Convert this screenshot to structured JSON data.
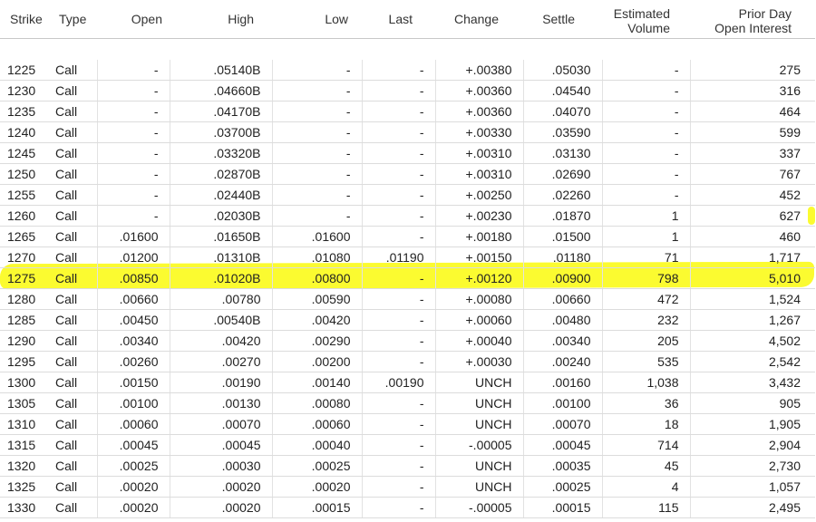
{
  "columns": {
    "strike": "Strike",
    "type": "Type",
    "open": "Open",
    "high": "High",
    "low": "Low",
    "last": "Last",
    "change": "Change",
    "settle": "Settle",
    "volume_line1": "Estimated",
    "volume_line2": "Volume",
    "oi_line1": "Prior Day",
    "oi_line2": "Open Interest"
  },
  "highlight_color": "#fbfb1e",
  "highlighted_strike": "1275",
  "rows": [
    {
      "strike": "1225",
      "type": "Call",
      "open": "-",
      "high": ".05140B",
      "low": "-",
      "last": "-",
      "change": "+.00380",
      "settle": ".05030",
      "volume": "-",
      "open_interest": "275"
    },
    {
      "strike": "1230",
      "type": "Call",
      "open": "-",
      "high": ".04660B",
      "low": "-",
      "last": "-",
      "change": "+.00360",
      "settle": ".04540",
      "volume": "-",
      "open_interest": "316"
    },
    {
      "strike": "1235",
      "type": "Call",
      "open": "-",
      "high": ".04170B",
      "low": "-",
      "last": "-",
      "change": "+.00360",
      "settle": ".04070",
      "volume": "-",
      "open_interest": "464"
    },
    {
      "strike": "1240",
      "type": "Call",
      "open": "-",
      "high": ".03700B",
      "low": "-",
      "last": "-",
      "change": "+.00330",
      "settle": ".03590",
      "volume": "-",
      "open_interest": "599"
    },
    {
      "strike": "1245",
      "type": "Call",
      "open": "-",
      "high": ".03320B",
      "low": "-",
      "last": "-",
      "change": "+.00310",
      "settle": ".03130",
      "volume": "-",
      "open_interest": "337"
    },
    {
      "strike": "1250",
      "type": "Call",
      "open": "-",
      "high": ".02870B",
      "low": "-",
      "last": "-",
      "change": "+.00310",
      "settle": ".02690",
      "volume": "-",
      "open_interest": "767"
    },
    {
      "strike": "1255",
      "type": "Call",
      "open": "-",
      "high": ".02440B",
      "low": "-",
      "last": "-",
      "change": "+.00250",
      "settle": ".02260",
      "volume": "-",
      "open_interest": "452"
    },
    {
      "strike": "1260",
      "type": "Call",
      "open": "-",
      "high": ".02030B",
      "low": "-",
      "last": "-",
      "change": "+.00230",
      "settle": ".01870",
      "volume": "1",
      "open_interest": "627"
    },
    {
      "strike": "1265",
      "type": "Call",
      "open": ".01600",
      "high": ".01650B",
      "low": ".01600",
      "last": "-",
      "change": "+.00180",
      "settle": ".01500",
      "volume": "1",
      "open_interest": "460"
    },
    {
      "strike": "1270",
      "type": "Call",
      "open": ".01200",
      "high": ".01310B",
      "low": ".01080",
      "last": ".01190",
      "change": "+.00150",
      "settle": ".01180",
      "volume": "71",
      "open_interest": "1,717"
    },
    {
      "strike": "1275",
      "type": "Call",
      "open": ".00850",
      "high": ".01020B",
      "low": ".00800",
      "last": "-",
      "change": "+.00120",
      "settle": ".00900",
      "volume": "798",
      "open_interest": "5,010"
    },
    {
      "strike": "1280",
      "type": "Call",
      "open": ".00660",
      "high": ".00780",
      "low": ".00590",
      "last": "-",
      "change": "+.00080",
      "settle": ".00660",
      "volume": "472",
      "open_interest": "1,524"
    },
    {
      "strike": "1285",
      "type": "Call",
      "open": ".00450",
      "high": ".00540B",
      "low": ".00420",
      "last": "-",
      "change": "+.00060",
      "settle": ".00480",
      "volume": "232",
      "open_interest": "1,267"
    },
    {
      "strike": "1290",
      "type": "Call",
      "open": ".00340",
      "high": ".00420",
      "low": ".00290",
      "last": "-",
      "change": "+.00040",
      "settle": ".00340",
      "volume": "205",
      "open_interest": "4,502"
    },
    {
      "strike": "1295",
      "type": "Call",
      "open": ".00260",
      "high": ".00270",
      "low": ".00200",
      "last": "-",
      "change": "+.00030",
      "settle": ".00240",
      "volume": "535",
      "open_interest": "2,542"
    },
    {
      "strike": "1300",
      "type": "Call",
      "open": ".00150",
      "high": ".00190",
      "low": ".00140",
      "last": ".00190",
      "change": "UNCH",
      "settle": ".00160",
      "volume": "1,038",
      "open_interest": "3,432"
    },
    {
      "strike": "1305",
      "type": "Call",
      "open": ".00100",
      "high": ".00130",
      "low": ".00080",
      "last": "-",
      "change": "UNCH",
      "settle": ".00100",
      "volume": "36",
      "open_interest": "905"
    },
    {
      "strike": "1310",
      "type": "Call",
      "open": ".00060",
      "high": ".00070",
      "low": ".00060",
      "last": "-",
      "change": "UNCH",
      "settle": ".00070",
      "volume": "18",
      "open_interest": "1,905"
    },
    {
      "strike": "1315",
      "type": "Call",
      "open": ".00045",
      "high": ".00045",
      "low": ".00040",
      "last": "-",
      "change": "-.00005",
      "settle": ".00045",
      "volume": "714",
      "open_interest": "2,904"
    },
    {
      "strike": "1320",
      "type": "Call",
      "open": ".00025",
      "high": ".00030",
      "low": ".00025",
      "last": "-",
      "change": "UNCH",
      "settle": ".00035",
      "volume": "45",
      "open_interest": "2,730"
    },
    {
      "strike": "1325",
      "type": "Call",
      "open": ".00020",
      "high": ".00020",
      "low": ".00020",
      "last": "-",
      "change": "UNCH",
      "settle": ".00025",
      "volume": "4",
      "open_interest": "1,057"
    },
    {
      "strike": "1330",
      "type": "Call",
      "open": ".00020",
      "high": ".00020",
      "low": ".00015",
      "last": "-",
      "change": "-.00005",
      "settle": ".00015",
      "volume": "115",
      "open_interest": "2,495"
    }
  ]
}
